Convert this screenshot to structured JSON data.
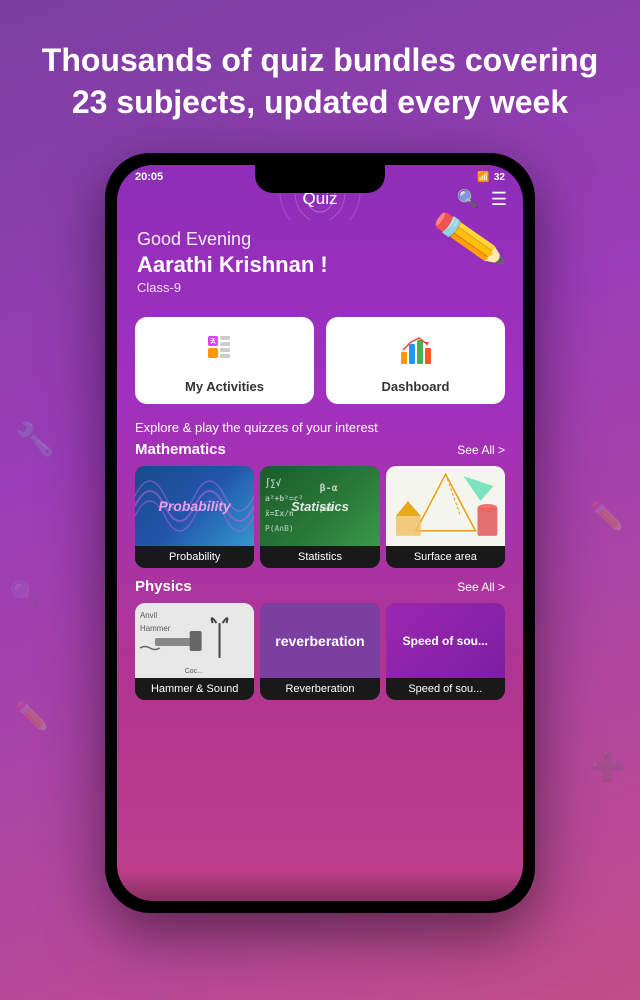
{
  "hero": {
    "tagline": "Thousands of quiz bundles covering 23 subjects, updated every week"
  },
  "status_bar": {
    "time": "20:05",
    "battery": "32",
    "signal": "●●●"
  },
  "app_bar": {
    "title": "Quiz",
    "search_icon": "🔍",
    "menu_icon": "☰"
  },
  "greeting": {
    "time_of_day": "Good Evening",
    "name": "Aarathi Krishnan !",
    "class": "Class-9"
  },
  "quick_actions": [
    {
      "label": "My Activities",
      "icon": "📋"
    },
    {
      "label": "Dashboard",
      "icon": "📊"
    }
  ],
  "explore_text": "Explore & play the quizzes of your interest",
  "subjects": [
    {
      "name": "Mathematics",
      "see_all": "See All >",
      "quizzes": [
        {
          "title": "Probability",
          "style": "probability"
        },
        {
          "title": "Statistics",
          "style": "statistics"
        },
        {
          "title": "Surface area",
          "style": "surface-area"
        }
      ]
    },
    {
      "name": "Physics",
      "see_all": "See All >",
      "quizzes": [
        {
          "title": "Hammer & Sound",
          "style": "hammer"
        },
        {
          "title": "Reverberation",
          "style": "reverb"
        },
        {
          "title": "Speed of sou...",
          "style": "speed"
        }
      ]
    }
  ],
  "colors": {
    "primary_purple": "#8e2eb8",
    "accent": "#c0408a",
    "white": "#ffffff"
  }
}
